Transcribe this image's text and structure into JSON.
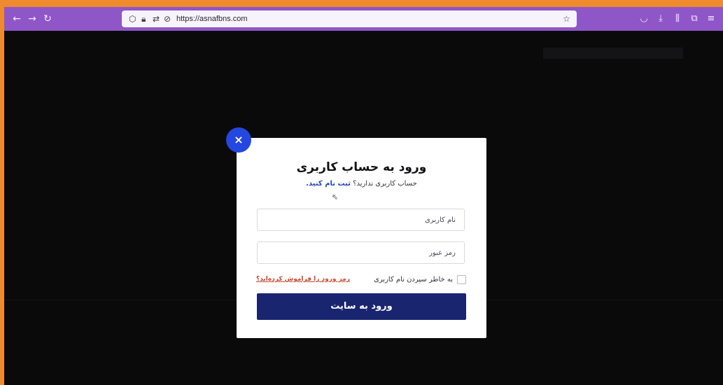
{
  "browser": {
    "url": "https://asnafbns.com",
    "accent_color": "#8f56c7"
  },
  "modal": {
    "title": "ورود به حساب کاربری",
    "subtitle_prefix": "حساب کاربری ندارید؟",
    "register_link": "ثبت نام کنید.",
    "username_placeholder": "نام کاربری",
    "password_placeholder": "رمز عبور",
    "remember_label": "به خاطر سپردن نام کاربری",
    "forgot_link": "رمز ورود را فراموش کرده‌اید؟",
    "submit_label": "ورود به سایت",
    "close_symbol": "×",
    "button_color": "#1a2570",
    "close_color": "#2447e0"
  }
}
